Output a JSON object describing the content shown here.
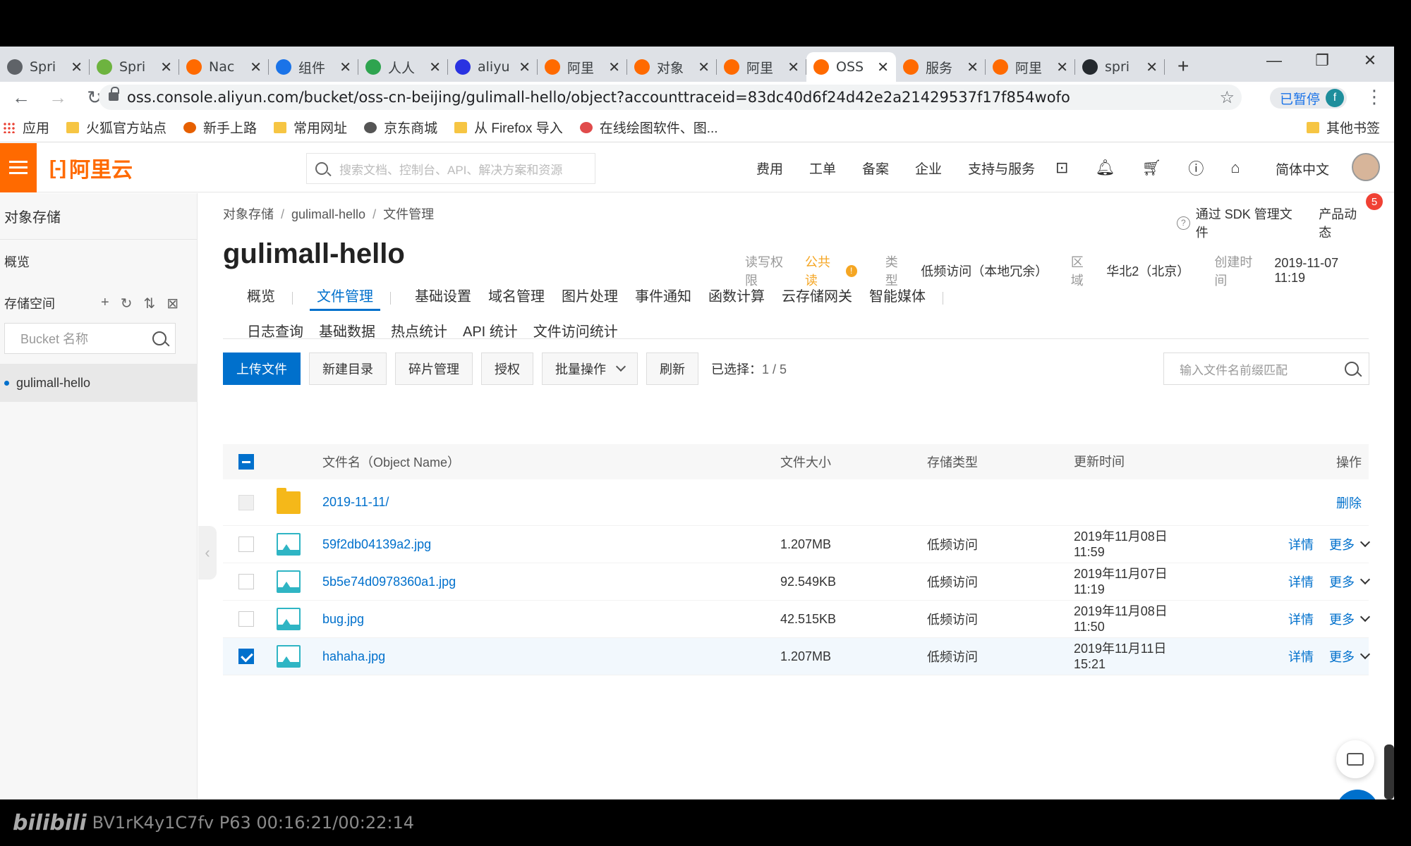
{
  "browser": {
    "tabs": [
      {
        "label": "Spri",
        "icon": "globe-icon",
        "color": "#5f6368"
      },
      {
        "label": "Spri",
        "icon": "spring-icon",
        "color": "#6db33f"
      },
      {
        "label": "Nac",
        "icon": "aliyun-icon",
        "color": "#ff6a00"
      },
      {
        "label": "组件",
        "icon": "shield-icon",
        "color": "#1a73e8"
      },
      {
        "label": "人人",
        "icon": "renren-icon",
        "color": "#2ea44f"
      },
      {
        "label": "aliyu",
        "icon": "baidu-icon",
        "color": "#2932e1"
      },
      {
        "label": "阿里",
        "icon": "aliyun-icon",
        "color": "#ff6a00"
      },
      {
        "label": "对象",
        "icon": "aliyun-icon",
        "color": "#ff6a00"
      },
      {
        "label": "阿里",
        "icon": "aliyun-icon",
        "color": "#ff6a00"
      },
      {
        "label": "OSS",
        "icon": "aliyun-icon",
        "color": "#ff6a00",
        "active": true
      },
      {
        "label": "服务",
        "icon": "aliyun-icon",
        "color": "#ff6a00"
      },
      {
        "label": "阿里",
        "icon": "aliyun-icon",
        "color": "#ff6a00"
      },
      {
        "label": "spri",
        "icon": "github-icon",
        "color": "#24292e"
      }
    ],
    "url": "oss.console.aliyun.com/bucket/oss-cn-beijing/gulimall-hello/object?accounttraceid=83dc40d6f24d42e2a21429537f17f854wofo",
    "paused_label": "已暂停",
    "profile_initial": "f",
    "bookmarks": [
      {
        "label": "应用",
        "icon": "apps-icon"
      },
      {
        "label": "火狐官方站点",
        "icon": "folder-icon"
      },
      {
        "label": "新手上路",
        "icon": "firefox-icon"
      },
      {
        "label": "常用网址",
        "icon": "folder-icon"
      },
      {
        "label": "京东商城",
        "icon": "globe-icon"
      },
      {
        "label": "从 Firefox 导入",
        "icon": "folder-icon"
      },
      {
        "label": "在线绘图软件、图...",
        "icon": "draw-icon"
      }
    ],
    "other_bookmarks": "其他书签"
  },
  "console": {
    "logo_text": "阿里云",
    "search_placeholder": "搜索文档、控制台、API、解决方案和资源",
    "nav": [
      "费用",
      "工单",
      "备案",
      "企业",
      "支持与服务"
    ],
    "language": "简体中文"
  },
  "sidebar": {
    "title": "对象存储",
    "overview": "概览",
    "storage_label": "存储空间",
    "bucket_placeholder": "Bucket 名称",
    "bucket": "gulimall-hello"
  },
  "main": {
    "breadcrumb": [
      "对象存储",
      "gulimall-hello",
      "文件管理"
    ],
    "sdk_link": "通过 SDK 管理文件",
    "product_news": "产品动态",
    "news_count": "5",
    "bucket_title": "gulimall-hello",
    "meta": {
      "acl_label": "读写权限",
      "acl_value": "公共读",
      "type_label": "类型",
      "type_value": "低频访问（本地冗余）",
      "region_label": "区域",
      "region_value": "华北2（北京）",
      "created_label": "创建时间",
      "created_value": "2019-11-07 11:19"
    },
    "tabs_row1": [
      "概览",
      "文件管理",
      "基础设置",
      "域名管理",
      "图片处理",
      "事件通知",
      "函数计算",
      "云存储网关",
      "智能媒体"
    ],
    "active_tab": "文件管理",
    "tabs_row2": [
      "日志查询",
      "基础数据",
      "热点统计",
      "API 统计",
      "文件访问统计"
    ],
    "toolbar": {
      "upload": "上传文件",
      "new_dir": "新建目录",
      "fragments": "碎片管理",
      "authorize": "授权",
      "batch": "批量操作",
      "refresh": "刷新",
      "selected_label": "已选择：",
      "selected_value": "1 / 5",
      "search_placeholder": "输入文件名前缀匹配"
    },
    "table": {
      "headers": {
        "name": "文件名（Object Name）",
        "size": "文件大小",
        "storage": "存储类型",
        "updated": "更新时间",
        "ops": "操作"
      },
      "rows": [
        {
          "name": "2019-11-11/",
          "kind": "folder",
          "size": "",
          "storage": "",
          "date": "",
          "time": "",
          "op1": "删除",
          "op2": "",
          "checked": false
        },
        {
          "name": "59f2db04139a2.jpg",
          "kind": "image",
          "size": "1.207MB",
          "storage": "低频访问",
          "date": "2019年11月08日",
          "time": "11:59",
          "op1": "详情",
          "op2": "更多",
          "checked": false
        },
        {
          "name": "5b5e74d0978360a1.jpg",
          "kind": "image",
          "size": "92.549KB",
          "storage": "低频访问",
          "date": "2019年11月07日",
          "time": "11:19",
          "op1": "详情",
          "op2": "更多",
          "checked": false
        },
        {
          "name": "bug.jpg",
          "kind": "image",
          "size": "42.515KB",
          "storage": "低频访问",
          "date": "2019年11月08日",
          "time": "11:50",
          "op1": "详情",
          "op2": "更多",
          "checked": false
        },
        {
          "name": "hahaha.jpg",
          "kind": "image",
          "size": "1.207MB",
          "storage": "低频访问",
          "date": "2019年11月11日",
          "time": "15:21",
          "op1": "详情",
          "op2": "更多",
          "checked": true
        }
      ]
    }
  },
  "video_overlay": {
    "brand": "bilibili",
    "info": "BV1rK4y1C7fv P63 00:16:21/00:22:14"
  }
}
